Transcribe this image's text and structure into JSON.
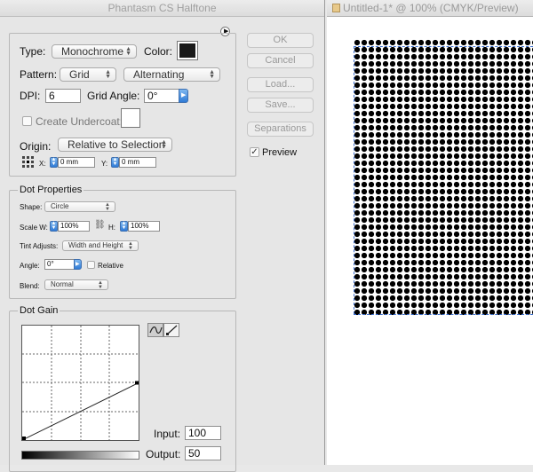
{
  "dialog": {
    "title": "Phantasm CS Halftone",
    "type_label": "Type:",
    "type_value": "Monochrome",
    "color_label": "Color:",
    "color_value": "#1a1a1a",
    "pattern_label": "Pattern:",
    "pattern_value": "Grid",
    "pattern_mode": "Alternating",
    "dpi_label": "DPI:",
    "dpi_value": "6",
    "grid_angle_label": "Grid Angle:",
    "grid_angle_value": "0°",
    "undercoat_label": "Create Undercoat:",
    "undercoat_checked": false,
    "origin_label": "Origin:",
    "origin_value": "Relative to Selection",
    "x_label": "X:",
    "x_value": "0 mm",
    "y_label": "Y:",
    "y_value": "0 mm"
  },
  "dot_properties": {
    "title": "Dot Properties",
    "shape_label": "Shape:",
    "shape_value": "Circle",
    "scale_label": "Scale W:",
    "scale_w": "100%",
    "h_label": "H:",
    "scale_h": "100%",
    "tint_label": "Tint Adjusts:",
    "tint_value": "Width and Height",
    "angle_label": "Angle:",
    "angle_value": "0°",
    "relative_label": "Relative",
    "relative_checked": false,
    "blend_label": "Blend:",
    "blend_value": "Normal"
  },
  "dot_gain": {
    "title": "Dot Gain",
    "input_label": "Input:",
    "input_value": "100",
    "output_label": "Output:",
    "output_value": "50",
    "curve_points": [
      [
        0,
        0
      ],
      [
        100,
        50
      ]
    ],
    "tools": [
      "smooth-curve-icon",
      "pencil-icon"
    ]
  },
  "buttons": {
    "ok": "OK",
    "cancel": "Cancel",
    "load": "Load...",
    "save": "Save...",
    "separations": "Separations"
  },
  "preview": {
    "label": "Preview",
    "checked": true
  },
  "document": {
    "title": "Untitled-1* @ 100% (CMYK/Preview)",
    "icon": "document-icon"
  },
  "colors": {
    "accent": "#3b7fd9",
    "selection": "#3b6fd1",
    "halftone_dot": "#000000"
  }
}
